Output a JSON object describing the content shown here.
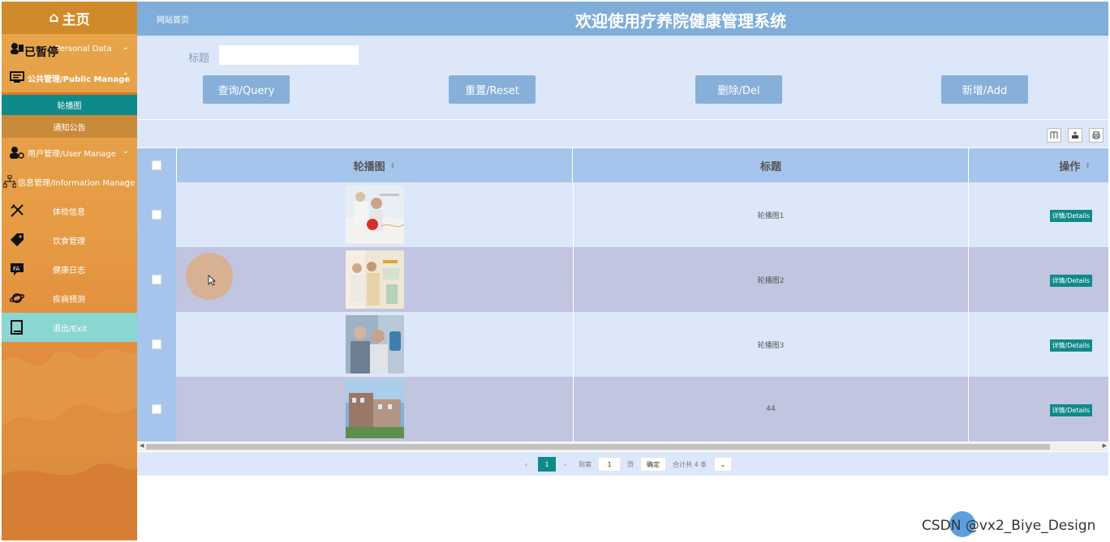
{
  "sidebar": {
    "home_label": "主页",
    "paused_text": "已暂停",
    "items": [
      {
        "label": "Personal Data",
        "icon": "user-card-icon",
        "expand": "⌄"
      },
      {
        "label": "公共管理/Public Manage",
        "icon": "monitor-icon",
        "expand": "⌃"
      },
      {
        "label": "用户管理/User Manage",
        "icon": "user-gear-icon",
        "expand": "⌄"
      },
      {
        "label": "信息管理/Information Manage",
        "icon": "sitemap-icon",
        "expand": "⌄"
      }
    ],
    "public_sub": [
      {
        "label": "轮播图"
      },
      {
        "label": "通知公告"
      }
    ],
    "info_sub": [
      {
        "label": "体检信息",
        "icon": "tools-icon"
      },
      {
        "label": "饮食管理",
        "icon": "tag-icon"
      },
      {
        "label": "健康日志",
        "icon": "chat-icon"
      },
      {
        "label": "疾病预测",
        "icon": "planet-icon"
      },
      {
        "label": "退出/Exit",
        "icon": "book-icon"
      }
    ]
  },
  "header": {
    "breadcrumb": "网站首页",
    "title": "欢迎使用疗养院健康管理系统"
  },
  "search": {
    "title_label": "标题",
    "title_value": "",
    "buttons": {
      "query": "查询/Query",
      "reset": "重置/Reset",
      "delete": "删除/Del",
      "add": "新增/Add"
    }
  },
  "toolbar": {
    "icons": [
      "columns-icon",
      "export-icon",
      "print-icon"
    ]
  },
  "table": {
    "columns": [
      "轮播图",
      "标题",
      "操作"
    ],
    "rows": [
      {
        "title": "轮播图1",
        "action": "详情/Details"
      },
      {
        "title": "轮播图2",
        "action": "详情/Details"
      },
      {
        "title": "轮播图3",
        "action": "详情/Details"
      },
      {
        "title": "44",
        "action": "详情/Details"
      }
    ]
  },
  "pager": {
    "current_page": "1",
    "goto_prefix": "到第",
    "goto_value": "1",
    "goto_suffix": "页",
    "confirm": "确定",
    "total": "合计共 4 条"
  },
  "watermark": "CSDN @vx2_Biye_Design",
  "colors": {
    "header": "#7faedb",
    "accent_teal": "#0f8a8a",
    "button": "#86afd9",
    "sidebar": "#e69c44"
  }
}
